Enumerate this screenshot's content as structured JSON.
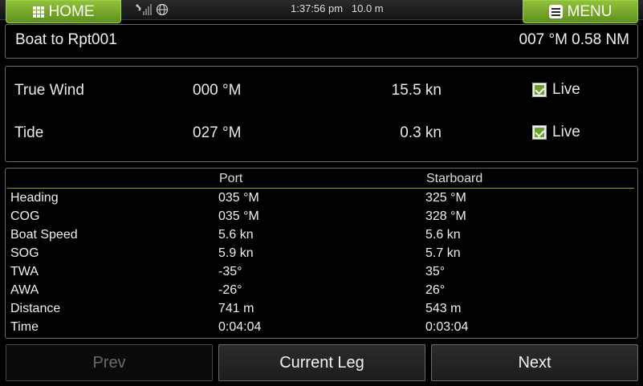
{
  "topbar": {
    "home_label": "HOME",
    "menu_label": "MENU",
    "time": "1:37:56 pm",
    "depth": "10.0 m",
    "accent_color": "#7cb030"
  },
  "destination": {
    "label": "Boat to Rpt001",
    "value": "007 °M 0.58 NM"
  },
  "environment": [
    {
      "label": "True Wind",
      "direction": "000 °M",
      "speed": "15.5 kn",
      "live_label": "Live",
      "live_checked": true
    },
    {
      "label": "Tide",
      "direction": "027 °M",
      "speed": "0.3 kn",
      "live_label": "Live",
      "live_checked": true
    }
  ],
  "table": {
    "headers": [
      "",
      "Port",
      "Starboard"
    ],
    "rows": [
      [
        "Heading",
        "035 °M",
        "325 °M"
      ],
      [
        "COG",
        "035 °M",
        "328 °M"
      ],
      [
        "Boat Speed",
        "5.6 kn",
        "5.6 kn"
      ],
      [
        "SOG",
        "5.9 kn",
        "5.7 kn"
      ],
      [
        "TWA",
        "-35°",
        "35°"
      ],
      [
        "AWA",
        "-26°",
        "26°"
      ],
      [
        "Distance",
        "741 m",
        "543 m"
      ],
      [
        "Time",
        "0:04:04",
        "0:03:04"
      ]
    ]
  },
  "buttons": {
    "prev": "Prev",
    "current_leg": "Current Leg",
    "next": "Next"
  }
}
